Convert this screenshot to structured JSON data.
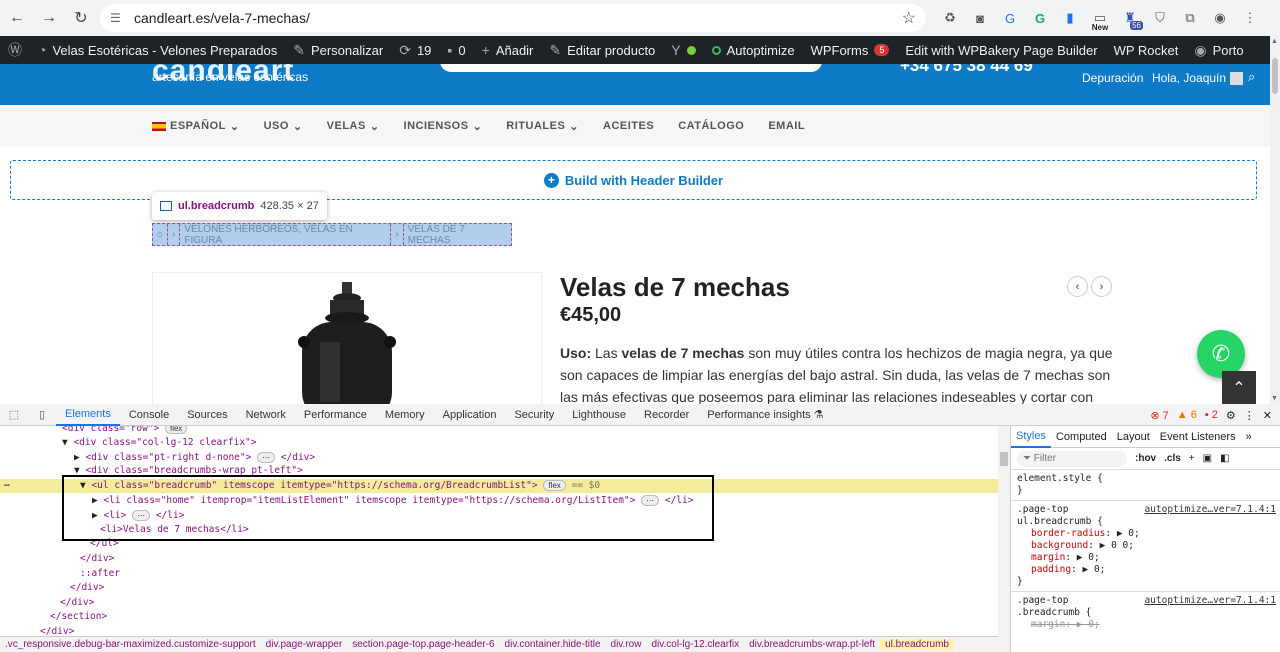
{
  "browser": {
    "url": "candleart.es/vela-7-mechas/",
    "ext_new": "New",
    "ext_badge": "56"
  },
  "wpbar": {
    "site_name": "Velas Esotéricas - Velones Preparados",
    "customize": "Personalizar",
    "updates_count": "19",
    "comments_count": "0",
    "add_new": "Añadir",
    "edit_product": "Editar producto",
    "autoptimize": "Autoptimize",
    "wpforms": "WPForms",
    "wpforms_count": "5",
    "wpbakery": "Edit with WPBakery Page Builder",
    "wprocket": "WP Rocket",
    "porto": "Porto"
  },
  "site": {
    "tagline": "artesanía en velas esotéricas",
    "phone": "+34 675 38 44 69",
    "debug": "Depuración",
    "greeting": "Hola, Joaquín",
    "menu": [
      "ESPAÑOL",
      "USO",
      "VELAS",
      "INCIENSOS",
      "RITUALES",
      "ACEITES",
      "CATÁLOGO",
      "EMAIL"
    ],
    "header_builder": "Build with Header Builder",
    "tooltip_selector": "ul.breadcrumb",
    "tooltip_dims": "428.35 × 27",
    "breadcrumb": [
      "⌂",
      "VELONES HERBÓREOS,  VELAS EN FIGURA",
      "VELAS DE 7 MECHAS"
    ],
    "product_title": "Velas de 7 mechas",
    "price": "€45,00",
    "desc_label": "Uso:",
    "desc_pre": " Las ",
    "desc_bold": "velas de 7 mechas",
    "desc_rest": " son muy útiles contra los hechizos de magia negra, ya que son capaces de limpiar las energías del bajo astral. Sin duda, las velas de 7 mechas son las más efectivas que poseemos para eliminar las relaciones indeseables y cortar con todo lo"
  },
  "devtools": {
    "tabs": [
      "Elements",
      "Console",
      "Sources",
      "Network",
      "Performance",
      "Memory",
      "Application",
      "Security",
      "Lighthouse",
      "Recorder",
      "Performance insights ⚗"
    ],
    "errors": "7",
    "warnings": "6",
    "issues": "2",
    "dom_lines": [
      "<div class=\"row\">",
      "<div class=\"col-lg-12 clearfix\">",
      "<div class=\"pt-right d-none\">",
      "<div class=\"breadcrumbs-wrap pt-left\">",
      "<ul class=\"breadcrumb\" itemscope itemtype=\"https://schema.org/BreadcrumbList\">",
      "<li class=\"home\" itemprop=\"itemListElement\" itemscope itemtype=\"https://schema.org/ListItem\">",
      "<li>",
      "<li>Velas de 7 mechas</li>",
      "</ul>",
      "</div>",
      "::after",
      "</div>",
      "</div>",
      "</section>"
    ],
    "selected_suffix": "== $0",
    "flex_pill": "flex",
    "crumbs": [
      ".vc_responsive.debug-bar-maximized.customize-support",
      "div.page-wrapper",
      "section.page-top.page-header-6",
      "div.container.hide-title",
      "div.row",
      "div.col-lg-12.clearfix",
      "div.breadcrumbs-wrap.pt-left",
      "ul.breadcrumb"
    ],
    "styles_tabs": [
      "Styles",
      "Computed",
      "Layout",
      "Event Listeners"
    ],
    "filter_placeholder": "Filter",
    "hov": ":hov",
    "cls": ".cls",
    "rule1_selector": "element.style {",
    "rule2_selector_a": ".page-top",
    "rule2_selector_b": "ul.breadcrumb {",
    "rule2_src": "autoptimize…ver=7.1.4:1",
    "rule2_props": [
      {
        "name": "border-radius",
        "value": "▶ 0;"
      },
      {
        "name": "background",
        "value": "▶ 0 0;"
      },
      {
        "name": "margin",
        "value": "▶ 0;"
      },
      {
        "name": "padding",
        "value": "▶ 0;"
      }
    ],
    "rule3_selector_a": ".page-top",
    "rule3_selector_b": ".breadcrumb {",
    "rule3_src": "autoptimize…ver=7.1.4:1",
    "rule3_prop": "margin: ▶ 0;"
  }
}
